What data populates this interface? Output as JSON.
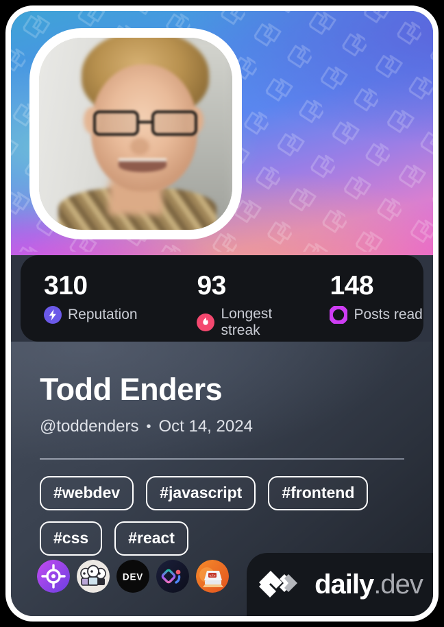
{
  "card": {
    "accent_border": "#ffffff",
    "background": "#000000"
  },
  "cover": {
    "gradient_colors": [
      "#3ea4d6",
      "#4d8fe8",
      "#5a86ef",
      "#9b7ee6",
      "#d97fd0",
      "#e85fd8"
    ],
    "watermark_icon": "daily-dev-chevron-pattern"
  },
  "avatar": {
    "icon": "user-avatar-photo",
    "alt": "Todd Enders profile photo"
  },
  "stats": [
    {
      "value": "310",
      "label": "Reputation",
      "icon": "lightning-bolt-icon",
      "color": "#6B59E8"
    },
    {
      "value": "93",
      "label": "Longest streak",
      "icon": "flame-icon",
      "color": "#F4486F"
    },
    {
      "value": "148",
      "label": "Posts read",
      "icon": "ring-icon",
      "color": "#CE3DF3"
    }
  ],
  "profile": {
    "name": "Todd Enders",
    "handle": "@toddenders",
    "separator": "•",
    "date": "Oct 14, 2024"
  },
  "tags": [
    "#webdev",
    "#javascript",
    "#frontend",
    "#css",
    "#react"
  ],
  "badges": [
    {
      "name": "target-crosshair-badge",
      "title": "Crosshair source"
    },
    {
      "name": "three-characters-badge",
      "title": "Community source"
    },
    {
      "name": "dev-to-badge",
      "title": "DEV",
      "label": "DEV"
    },
    {
      "name": "diamond-spark-badge",
      "title": "Diamond source"
    },
    {
      "name": "code-monitor-badge",
      "title": "Code monitor source"
    }
  ],
  "logo": {
    "mark": "daily-dev-chevron-logo",
    "name_primary": "daily",
    "name_secondary": ".dev",
    "primary_color": "#ffffff",
    "secondary_color": "#a8aab0"
  }
}
